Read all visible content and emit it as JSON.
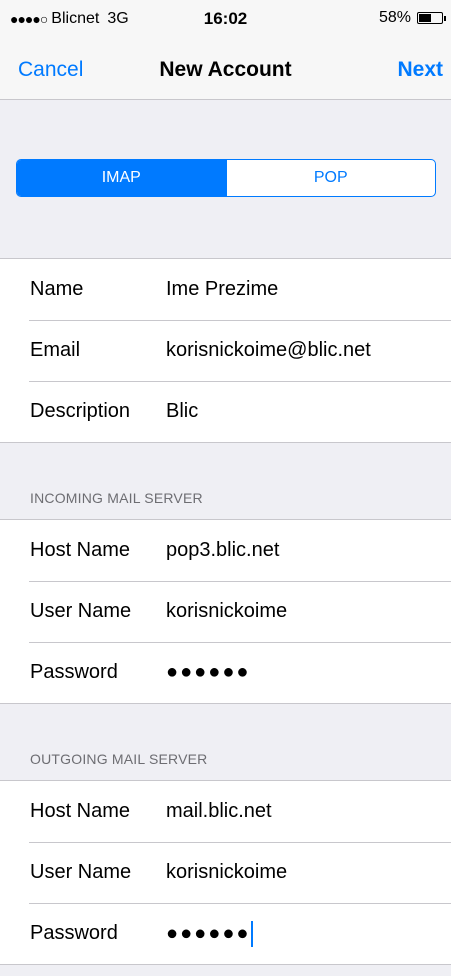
{
  "status_bar": {
    "signal": "●●●●○",
    "carrier": "Blicnet",
    "network": "3G",
    "time": "16:02",
    "battery_percent": "58%",
    "battery_level": 0.58
  },
  "nav": {
    "cancel_label": "Cancel",
    "title": "New Account",
    "next_label": "Next"
  },
  "account_type": {
    "options": [
      "IMAP",
      "POP"
    ],
    "selected": "IMAP"
  },
  "account_info": {
    "name_label": "Name",
    "name_value": "Ime Prezime",
    "email_label": "Email",
    "email_value": "korisnickoime@blic.net",
    "description_label": "Description",
    "description_value": "Blic"
  },
  "incoming": {
    "header": "INCOMING MAIL SERVER",
    "host_label": "Host Name",
    "host_value": "pop3.blic.net",
    "user_label": "User Name",
    "user_value": "korisnickoime",
    "password_label": "Password",
    "password_value": "●●●●●●"
  },
  "outgoing": {
    "header": "OUTGOING MAIL SERVER",
    "host_label": "Host Name",
    "host_value": "mail.blic.net",
    "user_label": "User Name",
    "user_value": "korisnickoime",
    "password_label": "Password",
    "password_value": "●●●●●●"
  },
  "colors": {
    "accent": "#007aff",
    "background": "#efeff4",
    "separator": "#c8c7cc"
  }
}
